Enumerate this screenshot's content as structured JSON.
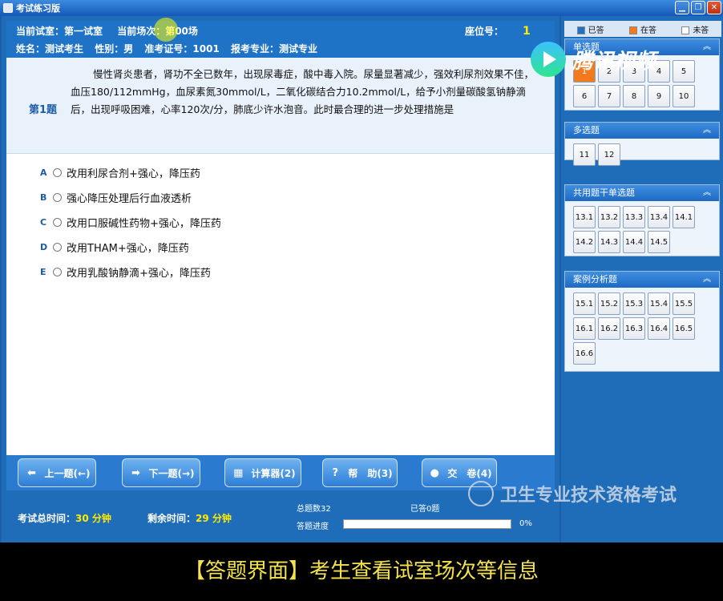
{
  "window": {
    "title": "考试练习版",
    "buttons": {
      "minimize": "▁",
      "restore": "❐",
      "close": "✕"
    }
  },
  "info": {
    "room": "当前试室：第一试室",
    "session": "当前场次：第00场",
    "seat_label": "座位号：",
    "seat_value": "1",
    "name": "姓名：测试考生",
    "gender": "性别：男",
    "ticket": "准考证号：1001",
    "major": "报考专业：测试专业"
  },
  "question": {
    "number": "第1题",
    "stem": "慢性肾炎患者，肾功不全已数年，出现尿毒症，酸中毒入院。尿量显著减少，强效利尿剂效果不佳，血压180/112mmHg，血尿素氮30mmol/L，二氧化碳结合力10.2mmol/L，给予小剂量碳酸氢钠静滴后，出现呼吸困难，心率120次/分，肺底少许水泡音。此时最合理的进一步处理措施是",
    "options": [
      {
        "letter": "A",
        "text": "改用利尿合剂+强心，降压药"
      },
      {
        "letter": "B",
        "text": "强心降压处理后行血液透析"
      },
      {
        "letter": "C",
        "text": "改用口服碱性药物+强心，降压药"
      },
      {
        "letter": "D",
        "text": "改用THAM+强心，降压药"
      },
      {
        "letter": "E",
        "text": "改用乳酸钠静滴+强心，降压药"
      }
    ]
  },
  "buttons": {
    "prev": "上一题(←)",
    "next": "下一题(→)",
    "calc": "计算器(2)",
    "help": "帮　助(3)",
    "submit": "交　卷(4)"
  },
  "status": {
    "total_time_label": "考试总时间：",
    "total_time_value": "30 分钟",
    "remain_label": "剩余时间：",
    "remain_value": "29 分钟",
    "total_count": "总题数32",
    "answered_count": "已答0题",
    "progress_label": "答题进度",
    "progress_value": "0%",
    "progress_fraction": 0
  },
  "legend": {
    "answered": "已答",
    "current": "在答",
    "unanswered": "未答",
    "answered_color": "#1e73c7",
    "current_color": "#f07a1d",
    "unanswered_color": "#ffffff"
  },
  "groups": [
    {
      "title": "单选题",
      "cells": [
        "1",
        "2",
        "3",
        "4",
        "5",
        "6",
        "7",
        "8",
        "9",
        "10"
      ]
    },
    {
      "title": "多选题",
      "cells": [
        "11",
        "12"
      ]
    },
    {
      "title": "共用题干单选题",
      "cells": [
        "13.1",
        "13.2",
        "13.3",
        "13.4",
        "14.1",
        "14.2",
        "14.3",
        "14.4",
        "14.5"
      ]
    },
    {
      "title": "案例分析题",
      "cells": [
        "15.1",
        "15.2",
        "15.3",
        "15.4",
        "15.5",
        "16.1",
        "16.2",
        "16.3",
        "16.4",
        "16.5",
        "16.6"
      ]
    }
  ],
  "watermark": {
    "brand": "腾讯视频",
    "exam": "卫生专业技术资格考试"
  },
  "caption": "【答题界面】考生查看试室场次等信息"
}
